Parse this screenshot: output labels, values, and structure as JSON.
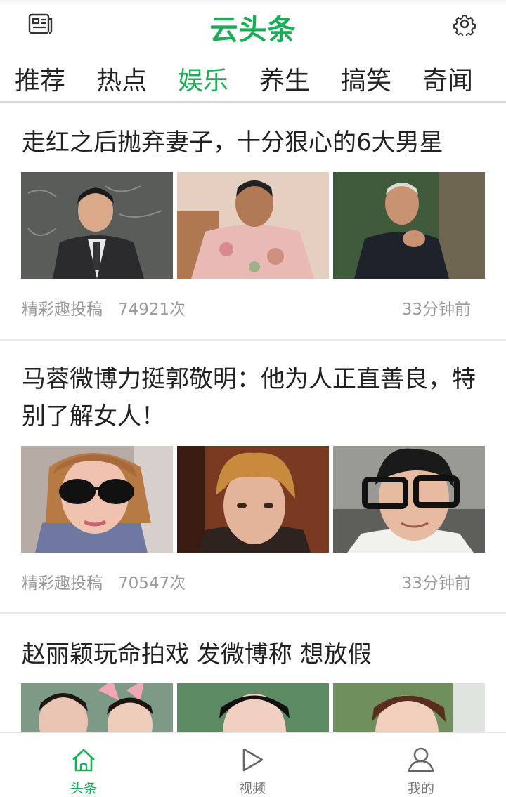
{
  "app": {
    "title": "云头条"
  },
  "tabs": [
    {
      "label": "推荐"
    },
    {
      "label": "热点"
    },
    {
      "label": "娱乐"
    },
    {
      "label": "养生"
    },
    {
      "label": "搞笑"
    },
    {
      "label": "奇闻"
    }
  ],
  "active_tab": "娱乐",
  "articles": [
    {
      "title": "走红之后抛弃妻子，十分狠心的6大男星",
      "source": "精彩趣投稿",
      "views": "74921次",
      "time": "33分钟前"
    },
    {
      "title": "马蓉微博力挺郭敬明：他为人正直善良，特别了解女人！",
      "source": "精彩趣投稿",
      "views": "70547次",
      "time": "33分钟前"
    },
    {
      "title": "赵丽颖玩命拍戏  发微博称  想放假"
    }
  ],
  "bottom_nav": [
    {
      "label": "头条",
      "icon": "home-icon"
    },
    {
      "label": "视频",
      "icon": "play-icon"
    },
    {
      "label": "我的",
      "icon": "user-icon"
    }
  ],
  "colors": {
    "accent": "#1aad55",
    "text": "#222222",
    "meta": "#999999"
  }
}
